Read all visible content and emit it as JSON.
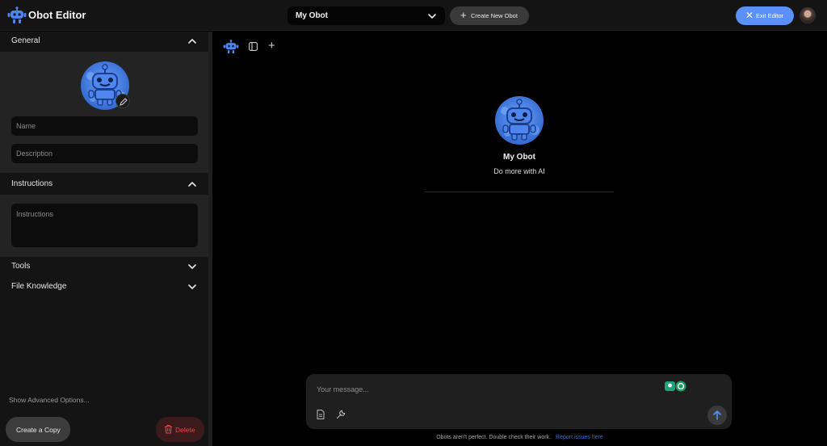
{
  "header": {
    "app_title": "Obot Editor",
    "selected_obot": "My Obot",
    "create_new_label": "Create New Obot",
    "exit_label": "Exit Editor"
  },
  "sidebar": {
    "general": {
      "title": "General",
      "name_placeholder": "Name",
      "description_placeholder": "Description"
    },
    "instructions": {
      "title": "Instructions",
      "placeholder": "Instructions"
    },
    "tools": {
      "title": "Tools"
    },
    "file_knowledge": {
      "title": "File Knowledge"
    },
    "advanced_label": "Show Advanced Options...",
    "copy_label": "Create a Copy",
    "delete_label": "Delete"
  },
  "chat": {
    "bot_name": "My Obot",
    "bot_description": "Do more with AI",
    "message_placeholder": "Your message...",
    "footer_text": "Obots aren't perfect. Double check their work.",
    "footer_link": "Report issues here"
  },
  "colors": {
    "accent": "#5b8ff9",
    "danger": "#e5484d",
    "panel": "#141414",
    "section_body": "#232323",
    "link": "#3d6dd8"
  },
  "icons": [
    "obot-logo-icon",
    "chevron-down-icon",
    "plus-icon",
    "close-icon",
    "chevron-up-icon",
    "pencil-icon",
    "trash-icon",
    "sidebar-panel-icon",
    "document-icon",
    "wrench-icon",
    "arrow-up-icon"
  ]
}
